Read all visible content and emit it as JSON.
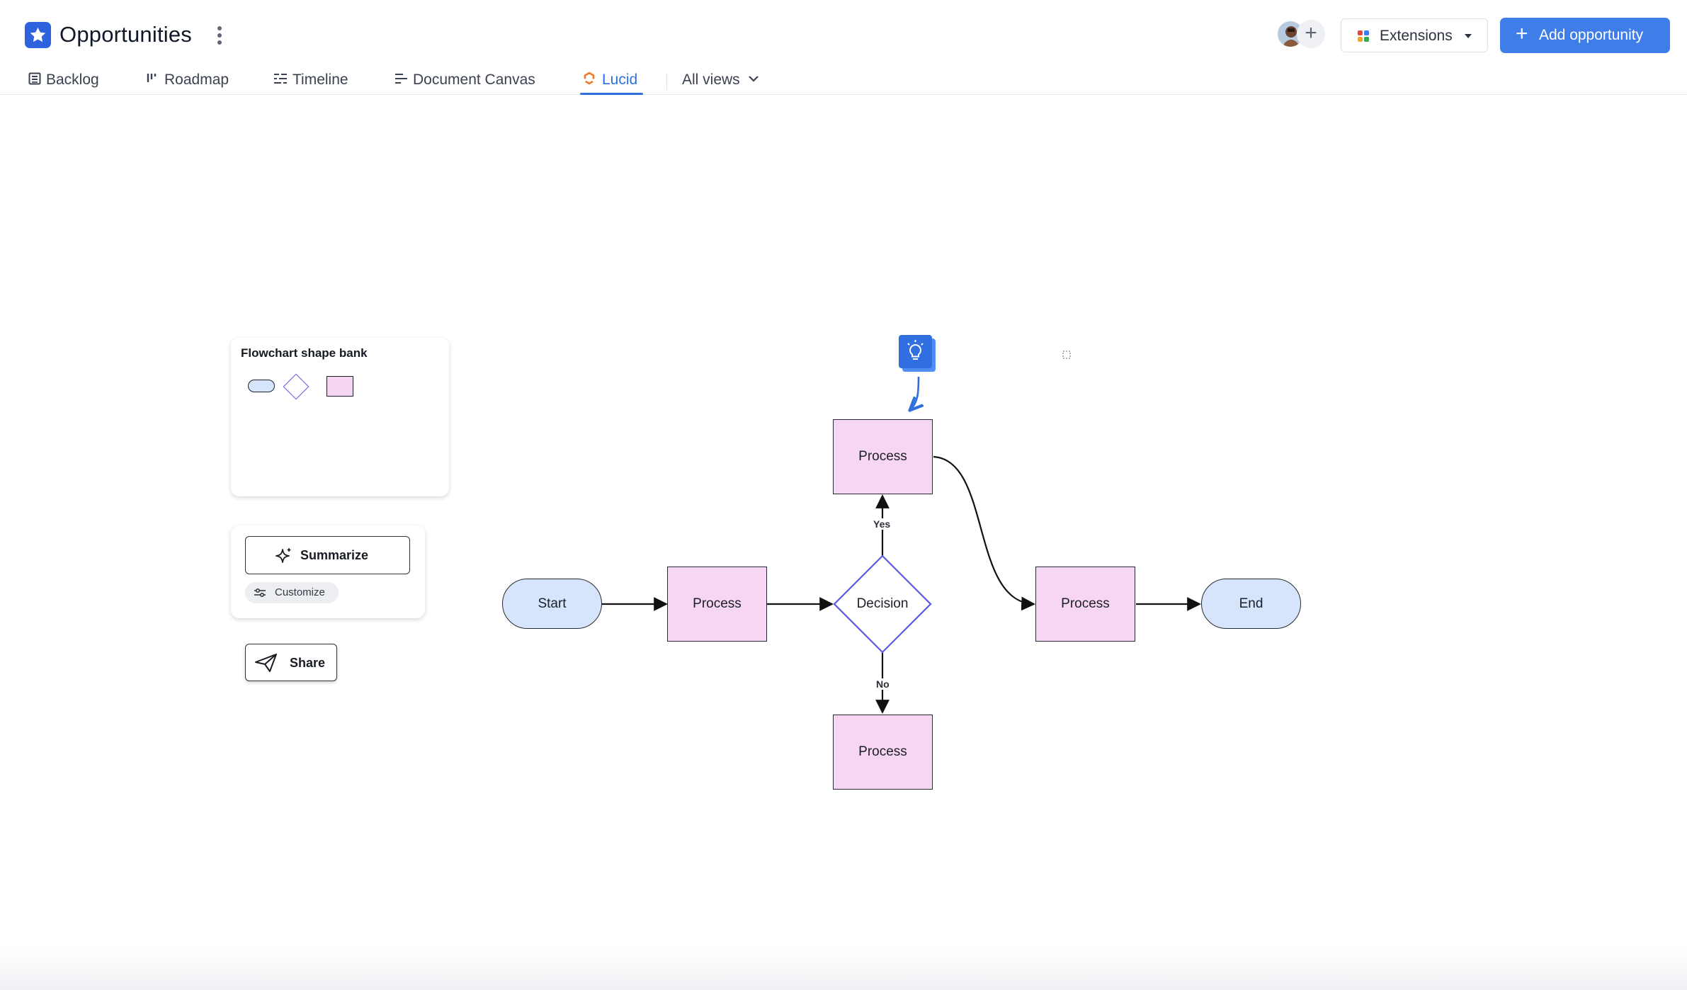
{
  "header": {
    "title": "Opportunities",
    "extensions_label": "Extensions",
    "add_label": "Add opportunity",
    "extension_colors": [
      "#e2483d",
      "#3b7ded",
      "#f5a623",
      "#34a853"
    ]
  },
  "tabs": [
    {
      "label": "Backlog",
      "icon": "backlog-icon"
    },
    {
      "label": "Roadmap",
      "icon": "roadmap-icon"
    },
    {
      "label": "Timeline",
      "icon": "timeline-icon"
    },
    {
      "label": "Document Canvas",
      "icon": "document-canvas-icon"
    },
    {
      "label": "Lucid",
      "icon": "lucid-icon",
      "active": true
    },
    {
      "label": "All views",
      "icon": "chevron-down-icon"
    }
  ],
  "shape_bank": {
    "title": "Flowchart shape bank",
    "shapes": [
      "terminal-shape",
      "decision-shape",
      "process-shape"
    ]
  },
  "actions": {
    "summarize_label": "Summarize",
    "customize_label": "Customize",
    "share_label": "Share"
  },
  "flowchart": {
    "nodes": {
      "start": "Start",
      "process_1": "Process",
      "decision": "Decision",
      "process_top": "Process",
      "process_bottom": "Process",
      "process_right": "Process",
      "end": "End"
    },
    "edge_labels": {
      "yes": "Yes",
      "no": "No"
    },
    "colors": {
      "terminal_fill": "#d6e5fb",
      "process_fill": "#f7d6f3",
      "decision_stroke": "#5a58e4",
      "accent": "#2f6fe0"
    }
  }
}
